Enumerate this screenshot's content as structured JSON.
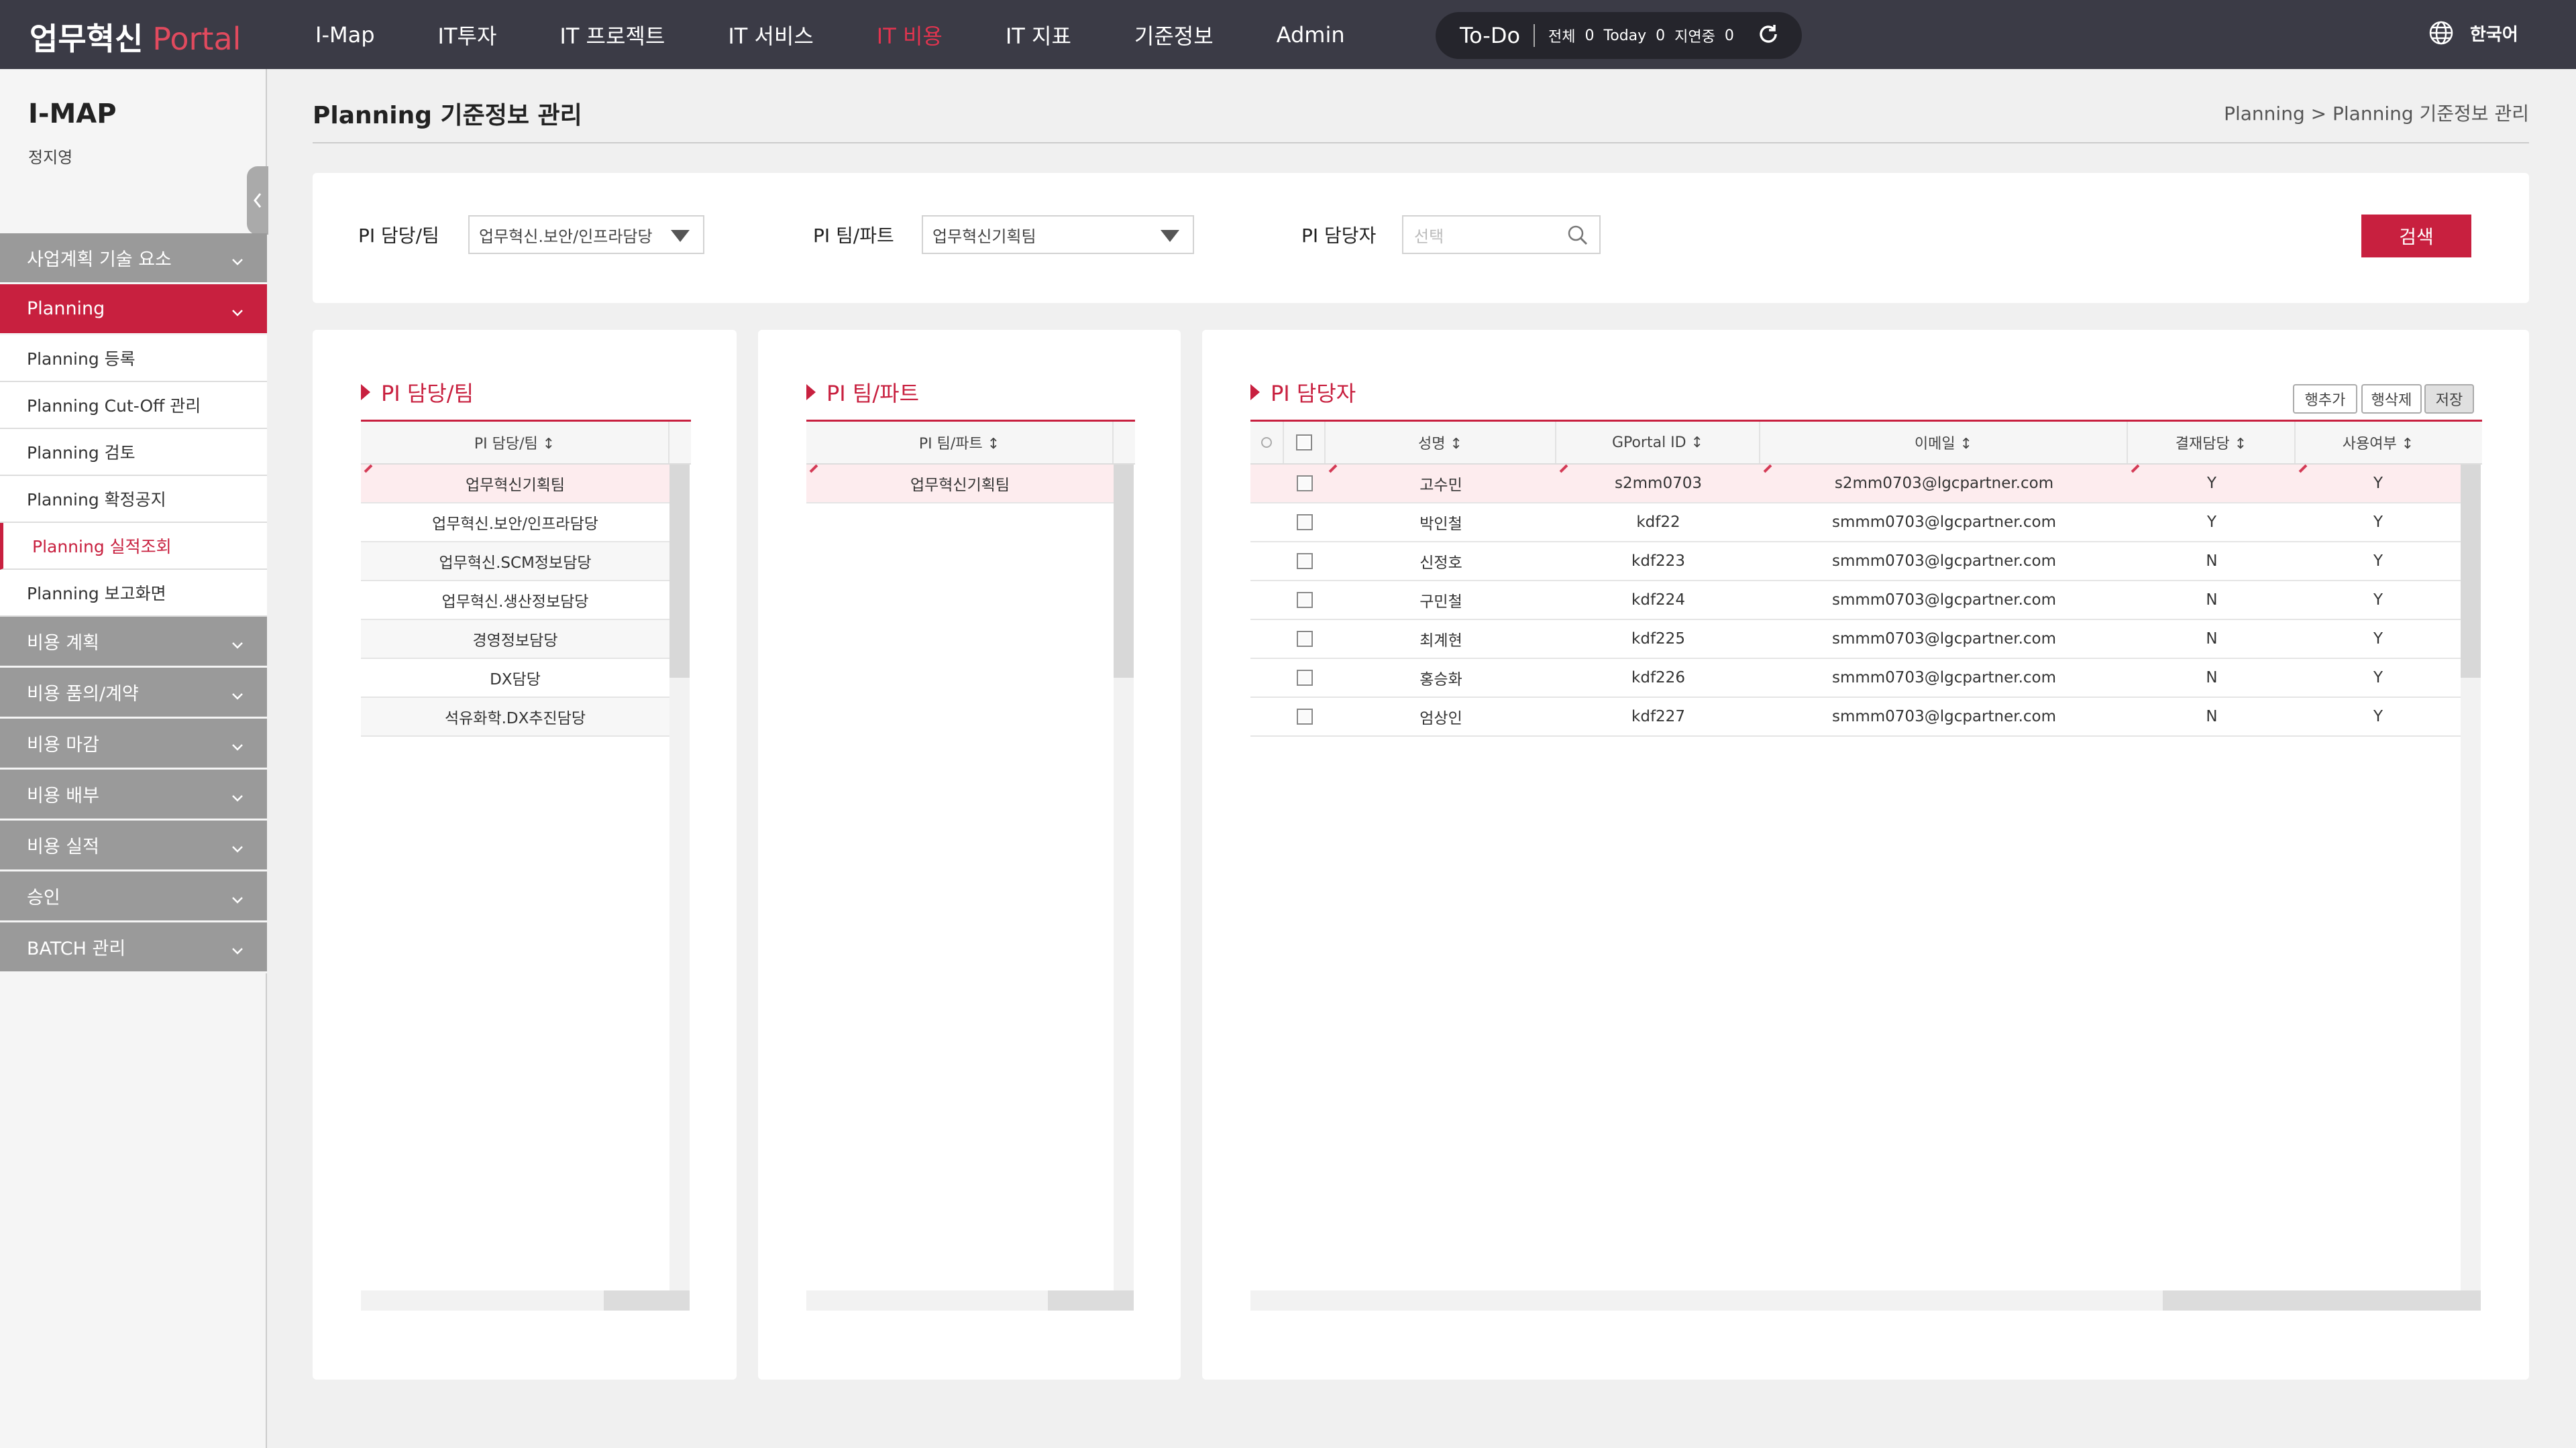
{
  "header": {
    "logo_main": "업무혁신",
    "logo_accent": "Portal",
    "menu": [
      {
        "label": "I-Map",
        "active": false
      },
      {
        "label": "IT투자",
        "active": false
      },
      {
        "label": "IT 프로젝트",
        "active": false
      },
      {
        "label": "IT 서비스",
        "active": false
      },
      {
        "label": "IT 비용",
        "active": true
      },
      {
        "label": "IT 지표",
        "active": false
      },
      {
        "label": "기준정보",
        "active": false
      },
      {
        "label": "Admin",
        "active": false
      }
    ],
    "todo": {
      "title": "To-Do",
      "all_label": "전체",
      "all_count": "0",
      "today_label": "Today",
      "today_count": "0",
      "delay_label": "지연중",
      "delay_count": "0"
    },
    "language": "한국어"
  },
  "sidebar": {
    "title": "I-MAP",
    "user": "정지영",
    "groups": [
      {
        "label": "사업계획 기술 요소",
        "open": false,
        "items": []
      },
      {
        "label": "Planning",
        "open": true,
        "items": [
          {
            "label": "Planning 등록",
            "current": false
          },
          {
            "label": "Planning Cut-Off 관리",
            "current": false
          },
          {
            "label": "Planning 검토",
            "current": false
          },
          {
            "label": "Planning 확정공지",
            "current": false
          },
          {
            "label": "Planning 실적조회",
            "current": true
          },
          {
            "label": "Planning 보고화면",
            "current": false
          }
        ]
      },
      {
        "label": "비용 계획",
        "open": false,
        "items": []
      },
      {
        "label": "비용 품의/계약",
        "open": false,
        "items": []
      },
      {
        "label": "비용 마감",
        "open": false,
        "items": []
      },
      {
        "label": "비용 배부",
        "open": false,
        "items": []
      },
      {
        "label": "비용 실적",
        "open": false,
        "items": []
      },
      {
        "label": "승인",
        "open": false,
        "items": []
      },
      {
        "label": "BATCH 관리",
        "open": false,
        "items": []
      }
    ]
  },
  "page": {
    "title": "Planning 기준정보 관리",
    "breadcrumb": [
      "Planning",
      "Planning 기준정보 관리"
    ]
  },
  "search": {
    "team_label": "PI 담당/팀",
    "team_value": "업무혁신.보안/인프라담당",
    "part_label": "PI 팀/파트",
    "part_value": "업무혁신기획팀",
    "manager_label": "PI 담당자",
    "manager_placeholder": "선택",
    "search_button": "검색"
  },
  "panel_team": {
    "title": "PI 담당/팀",
    "header": "PI 담당/팀 ↕",
    "rows": [
      "업무혁신기획팀",
      "업무혁신.보안/인프라담당",
      "업무혁신.SCM정보담당",
      "업무혁신.생산정보담당",
      "경영정보담당",
      "DX담당",
      "석유화학.DX추진담당"
    ]
  },
  "panel_part": {
    "title": "PI 팀/파트",
    "header": "PI 팀/파트 ↕",
    "rows": [
      "업무혁신기획팀"
    ]
  },
  "panel_manager": {
    "title": "PI 담당자",
    "buttons": {
      "add": "행추가",
      "delete": "행삭제",
      "save": "저장"
    },
    "headers": {
      "name": "성명 ↕",
      "gportal": "GPortal ID ↕",
      "email": "이메일 ↕",
      "approver": "결재담당 ↕",
      "use": "사용여부 ↕"
    },
    "rows": [
      {
        "name": "고수민",
        "gportal": "s2mm0703",
        "email": "s2mm0703@lgcpartner.com",
        "approver": "Y",
        "use": "Y"
      },
      {
        "name": "박인철",
        "gportal": "kdf22",
        "email": "smmm0703@lgcpartner.com",
        "approver": "Y",
        "use": "Y"
      },
      {
        "name": "신정호",
        "gportal": "kdf223",
        "email": "smmm0703@lgcpartner.com",
        "approver": "N",
        "use": "Y"
      },
      {
        "name": "구민철",
        "gportal": "kdf224",
        "email": "smmm0703@lgcpartner.com",
        "approver": "N",
        "use": "Y"
      },
      {
        "name": "최계현",
        "gportal": "kdf225",
        "email": "smmm0703@lgcpartner.com",
        "approver": "N",
        "use": "Y"
      },
      {
        "name": "홍승화",
        "gportal": "kdf226",
        "email": "smmm0703@lgcpartner.com",
        "approver": "N",
        "use": "Y"
      },
      {
        "name": "엄상인",
        "gportal": "kdf227",
        "email": "smmm0703@lgcpartner.com",
        "approver": "N",
        "use": "Y"
      }
    ]
  },
  "colors": {
    "accent": "#c8203f",
    "header_bg": "#3b3b46",
    "logo_accent": "#e14a5e"
  }
}
